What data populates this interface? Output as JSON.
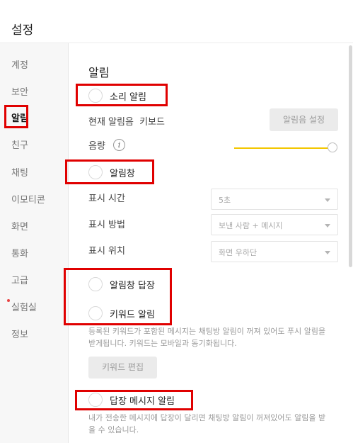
{
  "window": {
    "title": "설정"
  },
  "sidebar": {
    "items": [
      {
        "label": "계정"
      },
      {
        "label": "보안"
      },
      {
        "label": "알림"
      },
      {
        "label": "친구"
      },
      {
        "label": "채팅"
      },
      {
        "label": "이모티콘"
      },
      {
        "label": "화면"
      },
      {
        "label": "통화"
      },
      {
        "label": "고급"
      },
      {
        "label": "실험실"
      },
      {
        "label": "정보"
      }
    ],
    "active": "알림"
  },
  "main": {
    "section_title": "알림",
    "sound_alert": {
      "label": "소리 알림",
      "enabled": false
    },
    "current_sound": {
      "label": "현재 알림음",
      "value": "키보드",
      "button": "알림음 설정"
    },
    "volume": {
      "label": "음량",
      "info_icon": "i",
      "level": 1.0
    },
    "alert_window": {
      "label": "알림창",
      "enabled": false
    },
    "display_time": {
      "label": "표시 시간",
      "value": "5초"
    },
    "display_method": {
      "label": "표시 방법",
      "value": "보낸 사람 + 메시지"
    },
    "display_position": {
      "label": "표시 위치",
      "value": "화면 우하단"
    },
    "alert_reply": {
      "label": "알림창 답장",
      "enabled": false
    },
    "keyword_alert": {
      "label": "키워드 알림",
      "enabled": false,
      "description": "등록된 키워드가 포함된 메시지는 채팅방 알림이 꺼져 있어도 푸시 알림을 받게됩니다. 키워드는 모바일과 동기화됩니다.",
      "button": "키워드 편집"
    },
    "reply_message_alert": {
      "label": "답장 메시지 알림",
      "enabled": false,
      "description": "내가 전송한 메시지에 답장이 달리면 채팅방 알림이 꺼져있어도 알림을 받을 수 있습니다."
    }
  },
  "colors": {
    "accent": "#f3c600",
    "highlight": "#e00000"
  }
}
